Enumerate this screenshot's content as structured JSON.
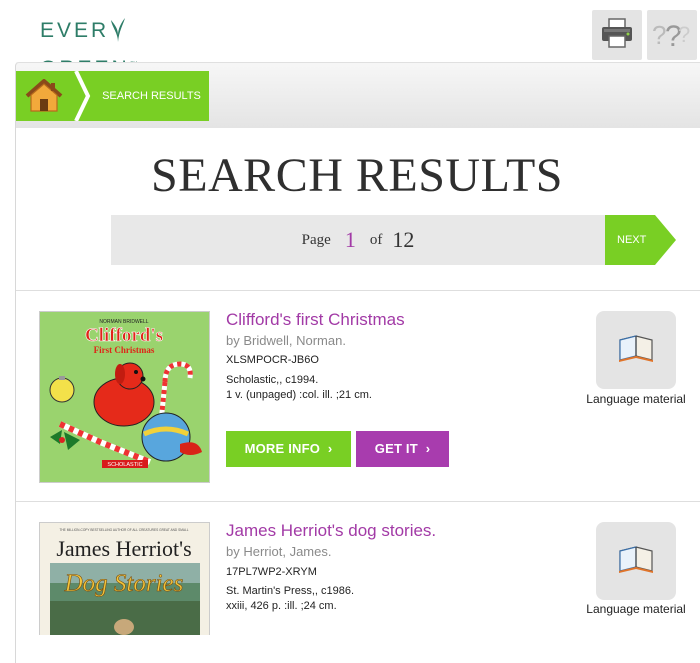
{
  "header": {
    "logo_left": "EVER",
    "logo_right": "GREEN",
    "logo_tm": "™",
    "print_icon": "printer-icon",
    "help_icon": "question-icon"
  },
  "breadcrumb": {
    "home_icon": "home-icon",
    "current": "SEARCH RESULTS"
  },
  "page_title": "SEARCH RESULTS",
  "pagination": {
    "page_label": "Page",
    "current": "1",
    "of_label": "of",
    "total": "12",
    "next_label": "NEXT"
  },
  "colors": {
    "accent_green": "#79cf24",
    "accent_purple": "#a83cae",
    "logo_green": "#2e7d68"
  },
  "results": [
    {
      "title": "Clifford's first Christmas",
      "author": "by Bridwell, Norman.",
      "id": "XLSMPOCR-JB6O",
      "publisher": "Scholastic,, c1994.",
      "physical": "1 v. (unpaged) :col. ill. ;21 cm.",
      "more_info": "MORE INFO",
      "get_it": "GET IT",
      "format_icon": "book-icon",
      "format_label": "Language material",
      "cover": {
        "author_line": "NORMAN BRIDWELL",
        "title_main": "Clifford's",
        "title_sub": "First Christmas",
        "publisher_mark": "SCHOLASTIC"
      }
    },
    {
      "title": "James Herriot's dog stories.",
      "author": "by Herriot, James.",
      "id": "17PL7WP2-XRYM",
      "publisher": "St. Martin's Press,, c1986.",
      "physical": "xxiii, 426 p. :ill. ;24 cm.",
      "format_icon": "book-icon",
      "format_label": "Language material",
      "cover": {
        "tagline": "THE MILLION-COPY BESTSELLING AUTHOR OF ALL CREATURES GREAT AND SMALL",
        "title_main": "James Herriot's",
        "title_sub": "Dog Stories"
      }
    }
  ]
}
